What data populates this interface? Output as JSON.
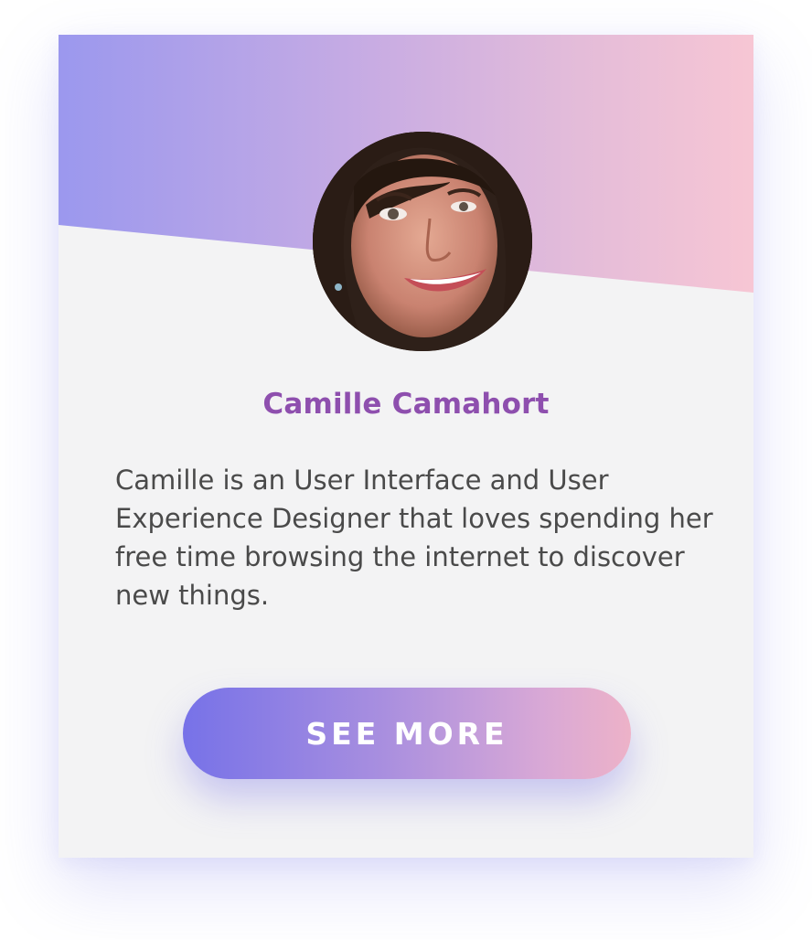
{
  "profile": {
    "name": "Camille Camahort",
    "bio": "Camille is an User Interface and User Experience Designer that loves spending her free time browsing the internet to discover new things.",
    "avatar_icon": "profile-photo"
  },
  "actions": {
    "see_more_label": "SEE MORE"
  },
  "colors": {
    "name_color": "#8e4fae",
    "gradient_start": "#9b98ee",
    "gradient_end": "#f7c6d4",
    "button_start": "#7772e8",
    "button_end": "#edb2c8",
    "card_bg": "#f3f3f4"
  }
}
